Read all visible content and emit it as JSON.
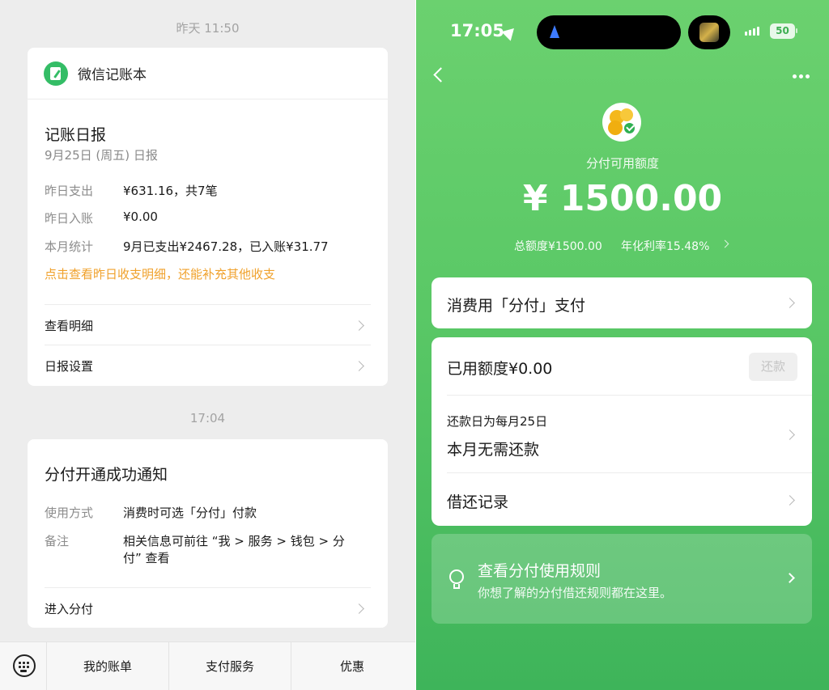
{
  "left": {
    "timestamp1": "昨天 11:50",
    "card1": {
      "app_name": "微信记账本",
      "title": "记账日报",
      "subtitle": "9月25日 (周五) 日报",
      "rows": [
        {
          "label": "昨日支出",
          "value": "¥631.16，共7笔"
        },
        {
          "label": "昨日入账",
          "value": "¥0.00"
        },
        {
          "label": "本月统计",
          "value": "9月已支出¥2467.28，已入账¥31.77"
        }
      ],
      "hint": "点击查看昨日收支明细，还能补充其他收支",
      "link1": "查看明细",
      "link2": "日报设置"
    },
    "timestamp2": "17:04",
    "card2": {
      "title": "分付开通成功通知",
      "rows": [
        {
          "label": "使用方式",
          "value": "消费时可选「分付」付款"
        },
        {
          "label": "备注",
          "value_line1": "相关信息可前往 “我 > 服务 > 钱包 > 分",
          "value_line2": "付” 查看"
        }
      ],
      "link": "进入分付"
    },
    "bottom_tabs": [
      "我的账单",
      "支付服务",
      "优惠"
    ]
  },
  "right": {
    "status": {
      "time": "17:05",
      "battery": "50"
    },
    "available_label": "分付可用额度",
    "available_amount": "¥ 1500.00",
    "total_quota": "总额度¥1500.00",
    "annual_rate": "年化利率15.48%",
    "consume_pay": "消费用「分付」支付",
    "used_quota": "已用额度¥0.00",
    "repay_button": "还款",
    "repay_day": "还款日为每月25日",
    "no_repay": "本月无需还款",
    "loan_record": "借还记录",
    "rules_title": "查看分付使用规则",
    "rules_sub": "你想了解的分付借还规则都在这里。"
  },
  "colors": {
    "brand_green": "#5ac866",
    "hint_orange": "#f0a12b",
    "coin_yellow": "#f4b81c"
  }
}
